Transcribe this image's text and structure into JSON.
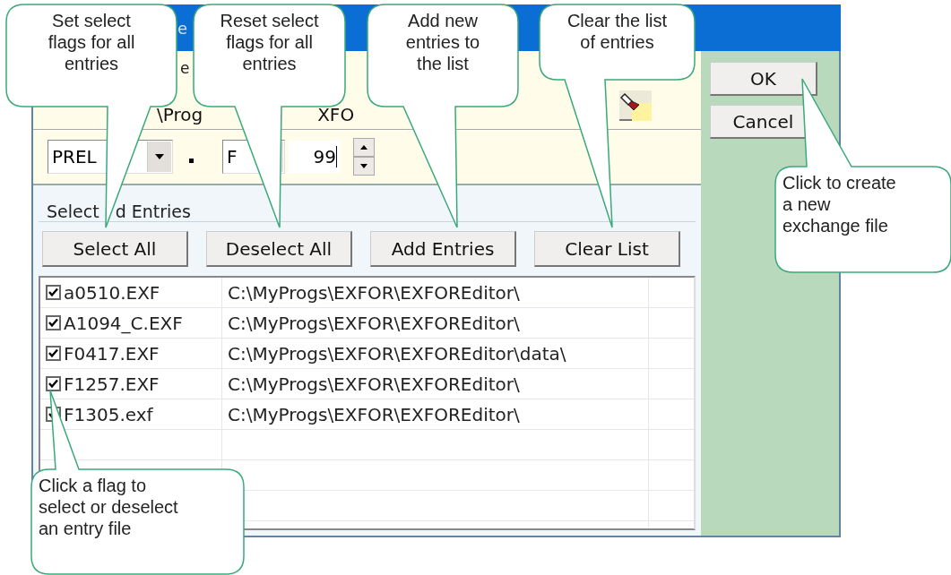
{
  "window": {
    "title_fragment": "e"
  },
  "file_section": {
    "label_fragment": "e",
    "path_fragments": [
      "\\Prog",
      "XFO"
    ]
  },
  "prefix_combo": {
    "value": "PREL"
  },
  "tape_combo": {
    "value": "F"
  },
  "year_field": {
    "value": "99"
  },
  "entries_group": {
    "legend_fragments": [
      "Select",
      "d Entries"
    ],
    "buttons": [
      "Select All",
      "Deselect All",
      "Add Entries",
      "Clear List"
    ],
    "rows": [
      {
        "file": "a0510.EXF",
        "path": "C:\\MyProgs\\EXFOR\\EXFOREditor\\",
        "checked": true
      },
      {
        "file": "A1094_C.EXF",
        "path": "C:\\MyProgs\\EXFOR\\EXFOREditor\\",
        "checked": true
      },
      {
        "file": "F0417.EXF",
        "path": "C:\\MyProgs\\EXFOR\\EXFOREditor\\data\\",
        "checked": true
      },
      {
        "file": "F1257.EXF",
        "path": "C:\\MyProgs\\EXFOR\\EXFOREditor\\",
        "checked": true
      },
      {
        "file": "F1305.exf",
        "path": "C:\\MyProgs\\EXFOR\\EXFOREditor\\",
        "checked": true
      }
    ]
  },
  "dialog_buttons": [
    "OK",
    "Cancel"
  ],
  "callouts": [
    "Set select\nflags for all\nentries",
    "Reset select\nflags for all\nentries",
    "Add new\nentries to\nthe list",
    "Clear the list\nof entries",
    "Click to create\na new\nexchange file",
    "Click a flag to\nselect or deselect\nan entry file"
  ]
}
